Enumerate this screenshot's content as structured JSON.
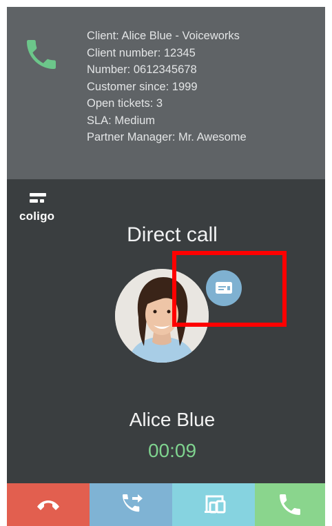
{
  "client_info": {
    "lines": [
      "Client: Alice Blue - Voiceworks",
      "Client number: 12345",
      "Number: 0612345678",
      "Customer since: 1999",
      "Open tickets: 3",
      "SLA: Medium",
      "Partner Manager: Mr. Awesome"
    ],
    "icon": "phone-icon"
  },
  "brand": {
    "logo_text": "coligo"
  },
  "call": {
    "type": "Direct call",
    "contact_name": "Alice Blue",
    "timer": "00:09"
  },
  "actions": [
    {
      "name": "hang-up",
      "icon": "hang-up-icon",
      "color": "#e25f4f"
    },
    {
      "name": "transfer",
      "icon": "call-transfer-icon",
      "color": "#7fb3d4"
    },
    {
      "name": "switch-device",
      "icon": "device-switch-icon",
      "color": "#86d3e0"
    },
    {
      "name": "call",
      "icon": "phone-icon",
      "color": "#8ad58d"
    }
  ],
  "colors": {
    "info_panel": "#5f6366",
    "background": "#3a3e40",
    "timer": "#7fd38f",
    "highlight": "#ff0000"
  }
}
